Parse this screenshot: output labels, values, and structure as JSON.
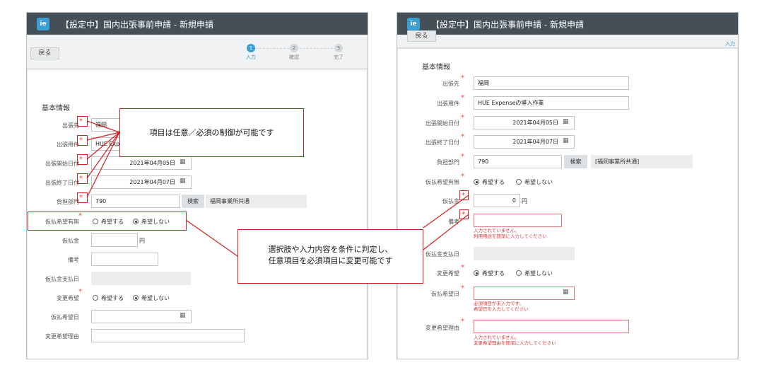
{
  "left": {
    "title": "【設定中】国内出張事前申請 - 新規申請",
    "back": "戻る",
    "steps": [
      {
        "num": "1",
        "label": "入力",
        "active": true
      },
      {
        "num": "2",
        "label": "確認",
        "active": false
      },
      {
        "num": "3",
        "label": "完了",
        "active": false
      }
    ],
    "section": "基本情報",
    "fields": {
      "dest_label": "出張先",
      "dest_value": "福岡",
      "purpose_label": "出張用件",
      "purpose_value": "HUE Exp",
      "start_label": "出張開始日付",
      "start_value": "2021年04月05日",
      "end_label": "出張終了日付",
      "end_value": "2021年04月07日",
      "dept_label": "負担部門",
      "dept_value": "790",
      "search": "検索",
      "dept_name": "福岡事業所共通",
      "advance_label": "仮払希望有無",
      "opt_yes": "希望する",
      "opt_no": "希望しない",
      "amount_label": "仮払金",
      "yen": "円",
      "note_label": "備考",
      "paydate_label": "仮払金支払日",
      "change_label": "変更希望",
      "advdate_label": "仮払希望日",
      "reason_label": "変更希望理由"
    },
    "callout1": "項目は任意／必須の制御が可能です",
    "callout2_line1": "選択肢や入力内容を条件に判定し、",
    "callout2_line2": "任意項目を必須項目に変更可能です"
  },
  "right": {
    "title": "【設定中】国内出張事前申請 - 新規申請",
    "back": "戻る",
    "step_label": "入力",
    "section": "基本情報",
    "fields": {
      "dest_label": "出張先",
      "dest_value": "福岡",
      "purpose_label": "出張用件",
      "purpose_value": "HUE Expenseの導入作業",
      "start_label": "出張開始日付",
      "start_value": "2021年04月05日",
      "end_label": "出張終了日付",
      "end_value": "2021年04月07日",
      "dept_label": "負担部門",
      "dept_value": "790",
      "search": "検索",
      "dept_name": "[福岡事業所共通]",
      "advance_label": "仮払希望有無",
      "opt_yes": "希望する",
      "opt_no": "希望しない",
      "amount_label": "仮払金",
      "amount_value": "0",
      "yen": "円",
      "note_label": "備考",
      "note_err1": "入力されていません。",
      "note_err2": "利用用途を簡潔に入力してください",
      "paydate_label": "仮払金支払日",
      "change_label": "変更希望",
      "advdate_label": "仮払希望日",
      "advdate_err1": "必須項目が未入力です。",
      "advdate_err2": "希望日を入力してください",
      "reason_label": "変更希望理由",
      "reason_err1": "入力されていません。",
      "reason_err2": "変更希望理由を簡潔に入力してください"
    }
  },
  "colors": {
    "accent": "#3b9fd3",
    "required": "#e8443f",
    "callout_border": "#d42020",
    "titlebar": "#444f57"
  },
  "icons": {
    "calendar": "calendar-icon",
    "logo": "app-logo-icon"
  }
}
